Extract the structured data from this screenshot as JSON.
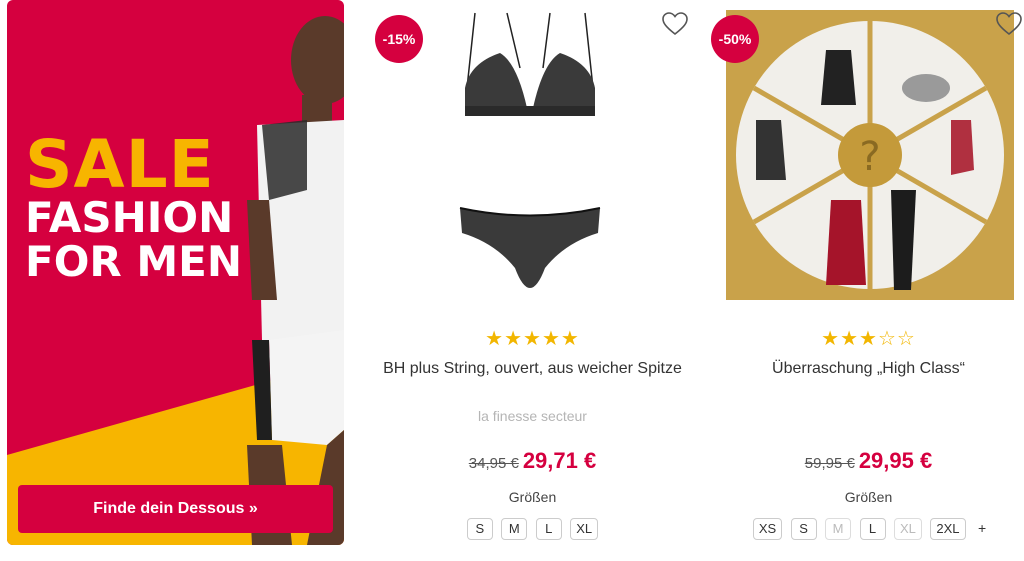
{
  "promo": {
    "line1": "SALE",
    "line2": "FASHION",
    "line3": "FOR MEN",
    "cta": "Finde dein Dessous »",
    "colors": {
      "red": "#d5003f",
      "yellow": "#f7b500"
    }
  },
  "products": [
    {
      "badge": "-15%",
      "rating": "★★★★★",
      "title": "BH plus String, ouvert, aus weicher Spitze",
      "brand": "la finesse secteur",
      "old_price": "34,95 €",
      "new_price": "29,71 €",
      "sizes_label": "Größen",
      "sizes": [
        "S",
        "M",
        "L",
        "XL"
      ]
    },
    {
      "badge": "-50%",
      "rating": "★★★☆☆",
      "title": "Überraschung „High Class“",
      "old_price": "59,95 €",
      "new_price": "29,95 €",
      "sizes_label": "Größen",
      "sizes": [
        "XS",
        "S",
        "M",
        "L",
        "XL",
        "2XL"
      ],
      "sizes_disabled": [
        "M",
        "XL"
      ],
      "more": "+"
    }
  ]
}
